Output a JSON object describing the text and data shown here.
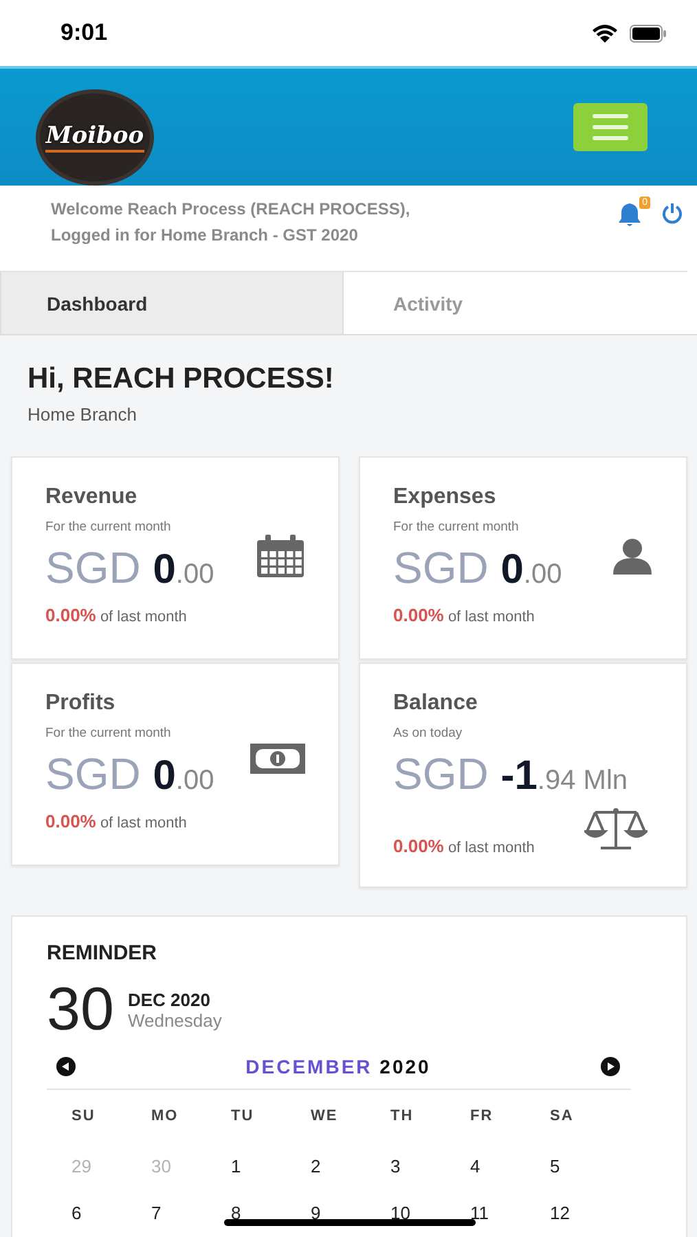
{
  "status_bar": {
    "time": "9:01"
  },
  "header": {
    "logo_text": "Moiboo"
  },
  "welcome": {
    "line1": "Welcome Reach Process (REACH PROCESS),",
    "line2": "Logged in for Home Branch - GST 2020",
    "notification_count": "0"
  },
  "tabs": [
    {
      "label": "Dashboard",
      "selected": true
    },
    {
      "label": "Activity",
      "selected": false
    }
  ],
  "greeting": {
    "title": "Hi, REACH PROCESS!",
    "subtitle": "Home Branch"
  },
  "cards": [
    {
      "title": "Revenue",
      "subtitle": "For the current month",
      "currency": "SGD",
      "amount": "0",
      "fraction": ".00",
      "change": "0.00%",
      "change_text": "of last month",
      "kind": "calendar"
    },
    {
      "title": "Expenses",
      "subtitle": "For the current month",
      "currency": "SGD",
      "amount": "0",
      "fraction": ".00",
      "change": "0.00%",
      "change_text": "of last month",
      "kind": "user"
    },
    {
      "title": "Profits",
      "subtitle": "For the current month",
      "currency": "SGD",
      "amount": "0",
      "fraction": ".00",
      "change": "0.00%",
      "change_text": "of last month",
      "kind": "money"
    },
    {
      "title": "Balance",
      "subtitle": "As on today",
      "currency": "SGD",
      "amount": "-1",
      "fraction": ".94 Mln",
      "change": "0.00%",
      "change_text": "of last month",
      "kind": "scale"
    }
  ],
  "reminder": {
    "title": "REMINDER",
    "day": "30",
    "month_year": "DEC 2020",
    "weekday": "Wednesday",
    "calendar": {
      "month": "DECEMBER",
      "year": "2020",
      "weekdays": [
        "SU",
        "MO",
        "TU",
        "WE",
        "TH",
        "FR",
        "SA"
      ],
      "days": [
        {
          "label": "29",
          "outside": true
        },
        {
          "label": "30",
          "outside": true
        },
        {
          "label": "1",
          "outside": false
        },
        {
          "label": "2",
          "outside": false
        },
        {
          "label": "3",
          "outside": false
        },
        {
          "label": "4",
          "outside": false
        },
        {
          "label": "5",
          "outside": false
        },
        {
          "label": "6",
          "outside": false
        },
        {
          "label": "7",
          "outside": false
        },
        {
          "label": "8",
          "outside": false
        },
        {
          "label": "9",
          "outside": false
        },
        {
          "label": "10",
          "outside": false
        },
        {
          "label": "11",
          "outside": false
        },
        {
          "label": "12",
          "outside": false
        }
      ]
    }
  }
}
